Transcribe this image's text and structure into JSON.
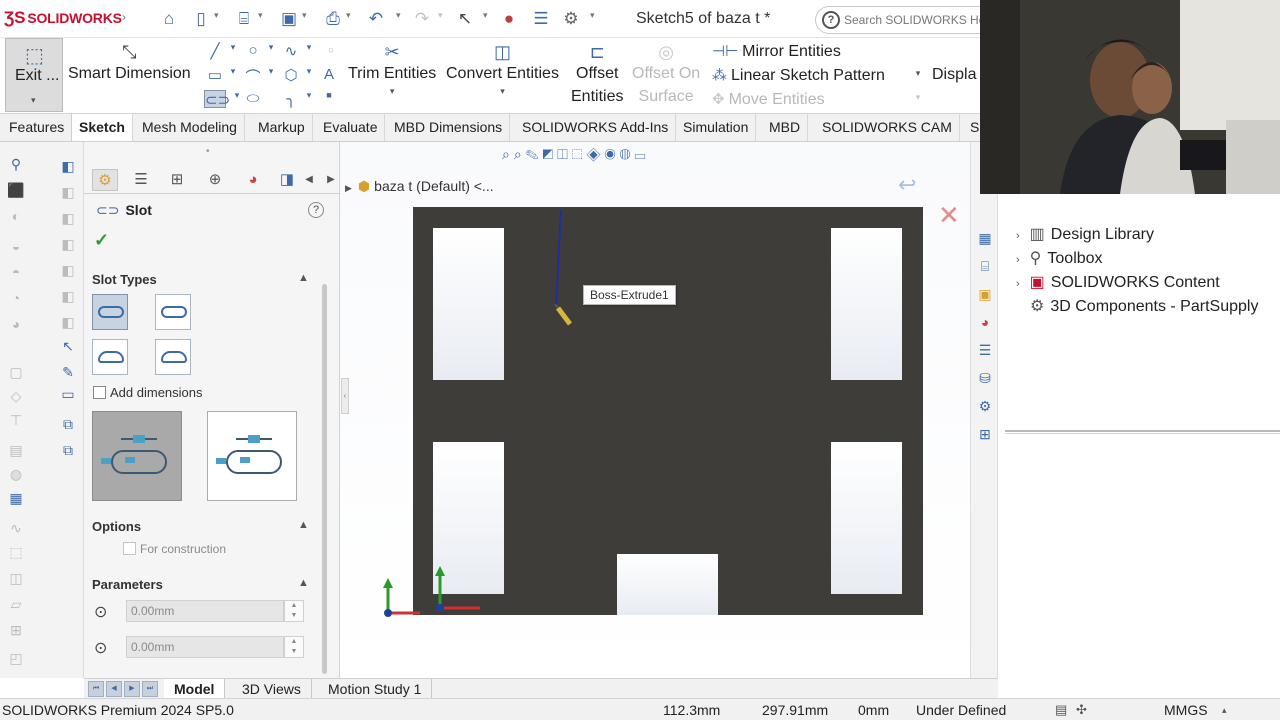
{
  "app": {
    "logo_text": "SOLIDWORKS",
    "document_title": "Sketch5 of baza t *",
    "search_placeholder": "Search SOLIDWORKS He"
  },
  "ribbon": {
    "exit_label": "Exit ...",
    "smart_dimension_label": "Smart Dimension",
    "trim_entities_label": "Trim Entities",
    "convert_entities_label": "Convert Entities",
    "offset_entities_line1": "Offset",
    "offset_entities_line2": "Entities",
    "offset_on_surface_line1": "Offset On",
    "offset_on_surface_line2": "Surface",
    "mirror_entities_label": "Mirror Entities",
    "linear_sketch_pattern_label": "Linear Sketch Pattern",
    "move_entities_label": "Move Entities",
    "display_label": "Displa"
  },
  "tabs": [
    "Features",
    "Sketch",
    "Mesh Modeling",
    "Markup",
    "Evaluate",
    "MBD Dimensions",
    "SOLIDWORKS Add-Ins",
    "Simulation",
    "MBD",
    "SOLIDWORKS CAM",
    "S"
  ],
  "active_tab": "Sketch",
  "property_manager": {
    "title": "Slot",
    "slot_types_header": "Slot Types",
    "add_dimensions_label": "Add dimensions",
    "options_header": "Options",
    "for_construction_label": "For construction",
    "parameters_header": "Parameters",
    "param1_value": "0.00mm",
    "param2_value": "0.00mm"
  },
  "viewport": {
    "breadcrumb": "baza t (Default) <...",
    "tooltip": "Boss-Extrude1"
  },
  "task_pane": {
    "items": [
      "Design Library",
      "Toolbox",
      "SOLIDWORKS Content",
      "3D Components - PartSupply"
    ]
  },
  "bottom_tabs": [
    "Model",
    "3D Views",
    "Motion Study 1"
  ],
  "status_bar": {
    "product": "SOLIDWORKS Premium 2024 SP5.0",
    "x_coord": "112.3mm",
    "y_coord": "297.91mm",
    "z_coord": "0mm",
    "sketch_state": "Under Defined",
    "units": "MMGS"
  },
  "colors": {
    "accent": "#3d6aa8",
    "brand_red": "#c8102e",
    "part_face": "#3e3d3a"
  }
}
